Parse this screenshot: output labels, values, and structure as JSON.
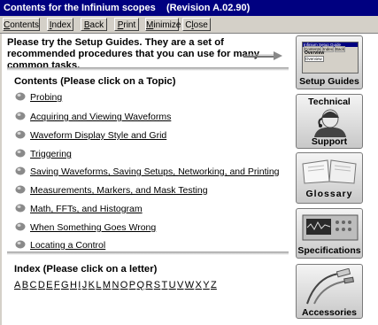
{
  "window": {
    "title": "Contents for the Infinium scopes    (Revision A.02.90)"
  },
  "menu": [
    {
      "pre": "",
      "ul": "C",
      "post": "ontents"
    },
    {
      "pre": "",
      "ul": "I",
      "post": "ndex"
    },
    {
      "pre": "",
      "ul": "B",
      "post": "ack"
    },
    {
      "pre": "",
      "ul": "P",
      "post": "rint"
    },
    {
      "pre": "",
      "ul": "M",
      "post": "inimize"
    },
    {
      "pre": "C",
      "ul": "l",
      "post": "ose"
    }
  ],
  "intro": {
    "text": "Please try the Setup Guides.  They are a set of recommended procedures that you can use for many common tasks."
  },
  "contents": {
    "heading": "Contents (Please click on a Topic)",
    "topics": [
      "Probing",
      "Acquiring and Viewing Waveforms",
      "Waveform Display Style and Grid",
      "Triggering",
      "Saving Waveforms, Saving Setups, Networking, and Printing",
      "Measurements, Markers, and Mask Testing",
      "Math, FFTs, and Histogram",
      "When Something Goes Wrong",
      "Locating a Control"
    ]
  },
  "index": {
    "heading": "Index (Please click on a letter)",
    "letters": [
      "A",
      "B",
      "C",
      "D",
      "E",
      "F",
      "G",
      "H",
      "I",
      "J",
      "K",
      "L",
      "M",
      "N",
      "O",
      "P",
      "Q",
      "R",
      "S",
      "T",
      "U",
      "V",
      "W",
      "X",
      "Y",
      "Z"
    ]
  },
  "tiles": {
    "setup_guides": "Setup Guides",
    "technical": "Technical",
    "support": "Support",
    "glossary": "Glossary",
    "specifications": "Specifications",
    "accessories": "Accessories"
  },
  "setup_thumb": {
    "title": "Infinium Setup Guide",
    "menu": [
      "Contents",
      "Index",
      "Back"
    ],
    "heading": "Overview",
    "tab": "Overview"
  },
  "colors": {
    "titlebar": "#000080",
    "menubar": "#d4d0c8",
    "bullet": "#8a8a8a"
  },
  "icons": {
    "bullet": "round-bullet-icon",
    "arrow": "right-arrow-icon"
  }
}
